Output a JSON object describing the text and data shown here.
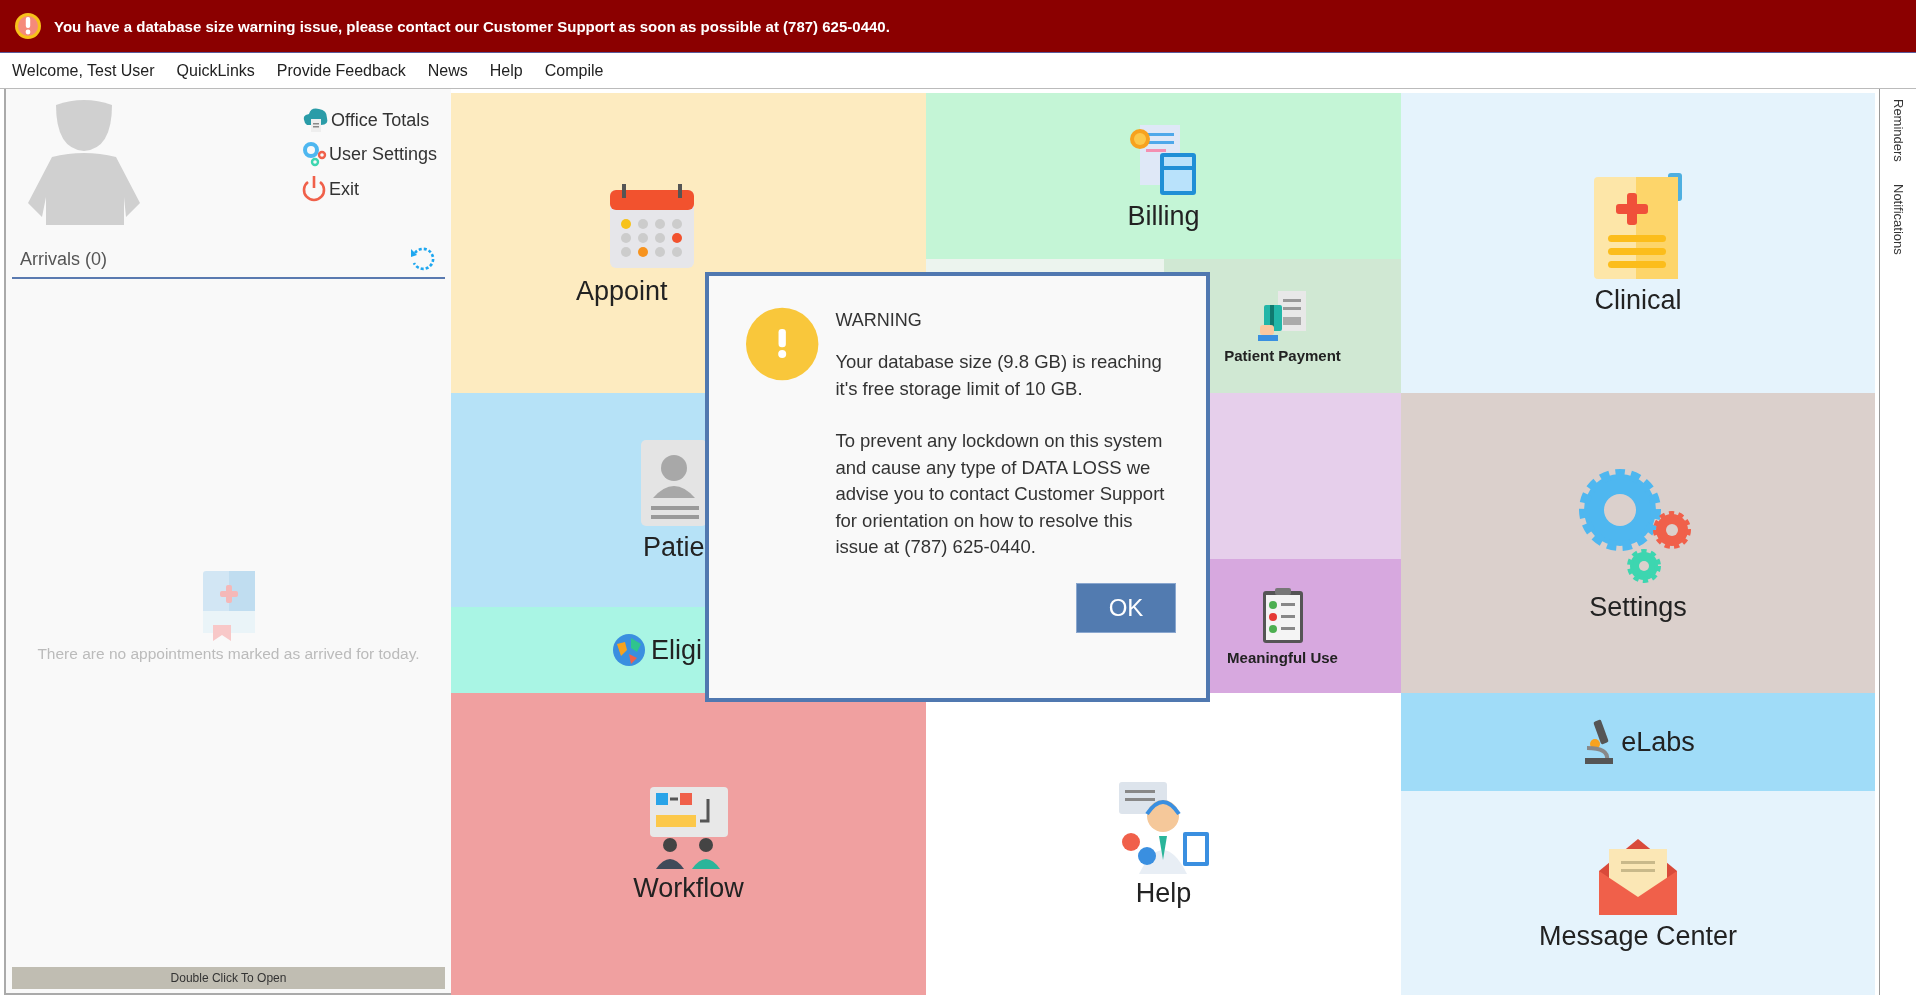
{
  "alert_banner": {
    "text": "You have a database size warning issue, please contact our Customer Support as soon as possible at (787) 625-0440."
  },
  "menu": [
    {
      "label": "Welcome, Test User"
    },
    {
      "label": "QuickLinks"
    },
    {
      "label": "Provide Feedback"
    },
    {
      "label": "News"
    },
    {
      "label": "Help"
    },
    {
      "label": "Compile"
    }
  ],
  "user_panel": {
    "links": [
      {
        "label": "Office Totals",
        "kind": "totals"
      },
      {
        "label": "User Settings",
        "kind": "settings"
      },
      {
        "label": "Exit",
        "kind": "exit"
      }
    ],
    "arrivals_title": "Arrivals (0)",
    "empty_message": "There are no appointments marked as arrived for today.",
    "footer_button": "Double Click To Open"
  },
  "tiles": [
    {
      "kind": "appointments",
      "label": "Appoint",
      "color": "#fdebc0"
    },
    {
      "kind": "billing",
      "label": "Billing",
      "color": "#c4f5d6"
    },
    {
      "kind": "clinical",
      "label": "Clinical",
      "color": "#e5f3fc"
    },
    {
      "kind": "patient-payment",
      "label": "Patient Payment",
      "color": "#d0e8d3"
    },
    {
      "kind": "patients",
      "label": "Patie",
      "color": "#b6e2f7"
    },
    {
      "kind": "empty",
      "color": "#e6cfeb"
    },
    {
      "kind": "settings",
      "label": "Settings",
      "color": "#dbd0cc"
    },
    {
      "kind": "eligibility",
      "label": "Eligi",
      "color": "#a9f5e4"
    },
    {
      "kind": "meaningful-use",
      "label": "Meaningful Use",
      "color": "#d7a8df"
    },
    {
      "kind": "workflow",
      "label": "Workflow",
      "color": "#f0a0a0"
    },
    {
      "kind": "help",
      "label": "Help",
      "color": "#ffffff"
    },
    {
      "kind": "elabs",
      "label": "eLabs",
      "color": "#a0dcf8"
    },
    {
      "kind": "message-center",
      "label": "Message Center",
      "color": "#e5f3fc"
    }
  ],
  "side_tabs": [
    {
      "label": "Reminders"
    },
    {
      "label": "Notifications"
    }
  ],
  "dialog": {
    "title": "WARNING",
    "paragraphs": [
      "Your database size (9.8 GB) is reaching it's free storage limit of 10 GB.",
      "To prevent any lockdown on this system and cause any type of DATA LOSS we advise you to contact Customer Support for orientation on how to resolve this issue at (787) 625-0440."
    ],
    "button": "OK"
  }
}
